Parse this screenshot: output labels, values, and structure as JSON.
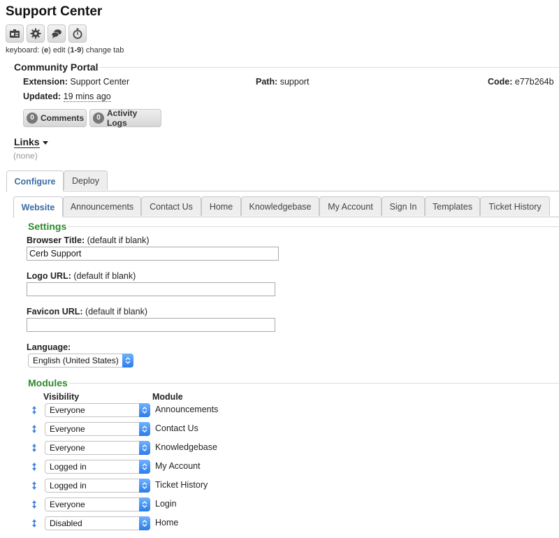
{
  "header": {
    "title": "Support Center",
    "toolbar": {
      "icons": [
        "id-card-icon",
        "gear-icon",
        "chat-bubbles-icon",
        "stopwatch-icon"
      ]
    },
    "keyboard_hint": {
      "prefix": "keyboard: (",
      "edit_key": "e",
      "edit_text": ") edit (",
      "tab_keys": "1-9",
      "tab_text": ") change tab"
    }
  },
  "portal": {
    "heading": "Community Portal",
    "extension_label": "Extension:",
    "extension_value": "Support Center",
    "path_label": "Path:",
    "path_value": "support",
    "code_label": "Code:",
    "code_value": "e77b264b",
    "updated_label": "Updated:",
    "updated_value": "19 mins ago",
    "buttons": {
      "comments": {
        "count": "0",
        "label": "Comments"
      },
      "activity": {
        "count": "0",
        "label": "Activity Logs"
      }
    }
  },
  "links": {
    "heading": "Links",
    "empty_text": "(none)"
  },
  "outer_tabs": [
    "Configure",
    "Deploy"
  ],
  "inner_tabs": [
    "Website",
    "Announcements",
    "Contact Us",
    "Home",
    "Knowledgebase",
    "My Account",
    "Sign In",
    "Templates",
    "Ticket History"
  ],
  "settings": {
    "heading": "Settings",
    "browser_title": {
      "label": "Browser Title:",
      "hint": "(default if blank)",
      "value": "Cerb Support"
    },
    "logo_url": {
      "label": "Logo URL:",
      "hint": "(default if blank)",
      "value": ""
    },
    "favicon_url": {
      "label": "Favicon URL:",
      "hint": "(default if blank)",
      "value": ""
    },
    "language": {
      "label": "Language:",
      "value": "English (United States)"
    }
  },
  "modules": {
    "heading": "Modules",
    "col_visibility": "Visibility",
    "col_module": "Module",
    "rows": [
      {
        "visibility": "Everyone",
        "module": "Announcements"
      },
      {
        "visibility": "Everyone",
        "module": "Contact Us"
      },
      {
        "visibility": "Everyone",
        "module": "Knowledgebase"
      },
      {
        "visibility": "Logged in",
        "module": "My Account"
      },
      {
        "visibility": "Logged in",
        "module": "Ticket History"
      },
      {
        "visibility": "Everyone",
        "module": "Login"
      },
      {
        "visibility": "Disabled",
        "module": "Home"
      }
    ]
  },
  "colors": {
    "accent_tab": "#3a6ea5",
    "section_green": "#2c8a2c",
    "select_blue": "#2a7de9"
  }
}
